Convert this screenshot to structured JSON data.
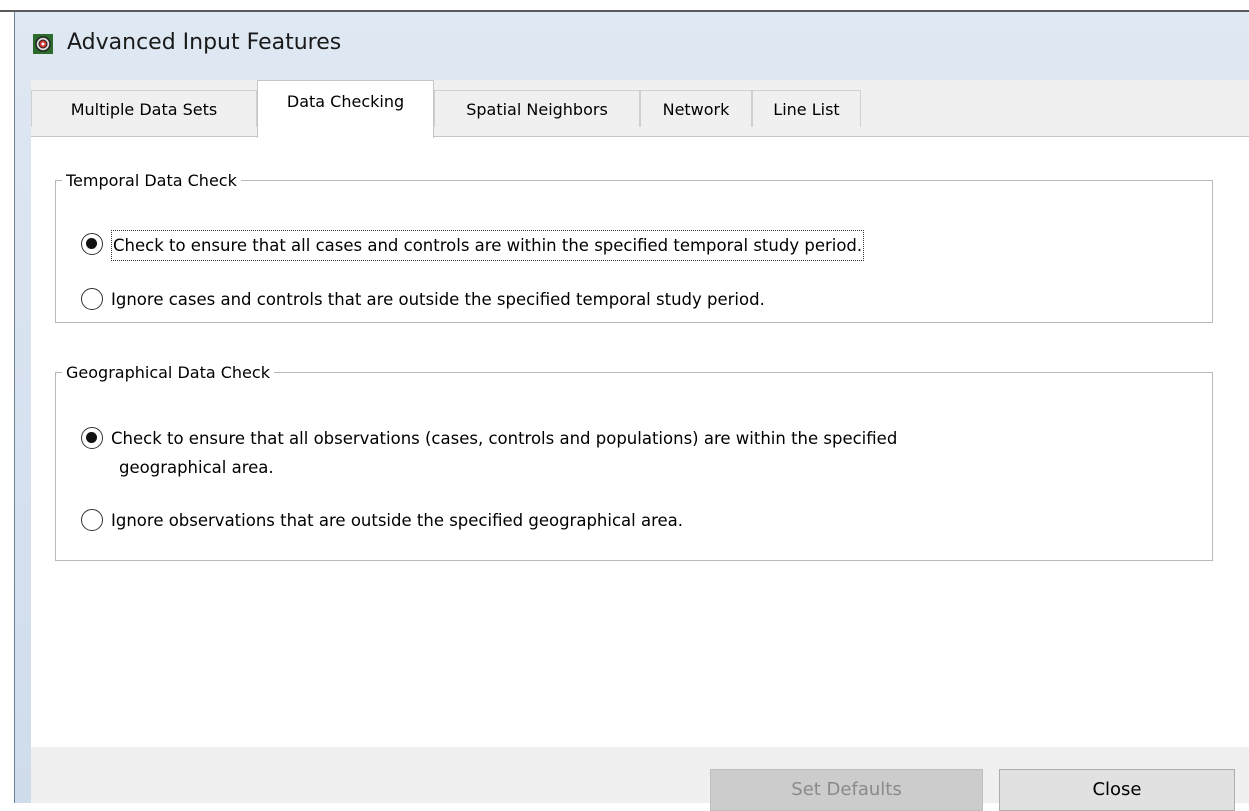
{
  "window": {
    "title": "Advanced Input Features"
  },
  "tabs": [
    {
      "label": "Multiple Data Sets"
    },
    {
      "label": "Data Checking"
    },
    {
      "label": "Spatial Neighbors"
    },
    {
      "label": "Network"
    },
    {
      "label": "Line List"
    }
  ],
  "active_tab": "Data Checking",
  "temporal": {
    "legend": "Temporal Data Check",
    "options": [
      {
        "label": "Check to ensure that all cases and controls are within the specified temporal study period.",
        "selected": true
      },
      {
        "label": "Ignore cases and controls that are outside the specified temporal study period.",
        "selected": false
      }
    ]
  },
  "geographical": {
    "legend": "Geographical Data Check",
    "options": [
      {
        "label_line1": "Check to ensure that all observations (cases, controls and populations) are within the specified",
        "label_line2": "geographical area.",
        "selected": true
      },
      {
        "label": "Ignore observations that are outside the specified geographical area.",
        "selected": false
      }
    ]
  },
  "buttons": {
    "set_defaults": "Set Defaults",
    "close": "Close"
  },
  "colors": {
    "accent": "#2b6cb0",
    "title_gradient_top": "#dfe8f3",
    "title_gradient_bottom": "#cfdcec",
    "panel_bg": "#f0f0f0"
  },
  "icons": {
    "app": "globe-target-icon"
  }
}
